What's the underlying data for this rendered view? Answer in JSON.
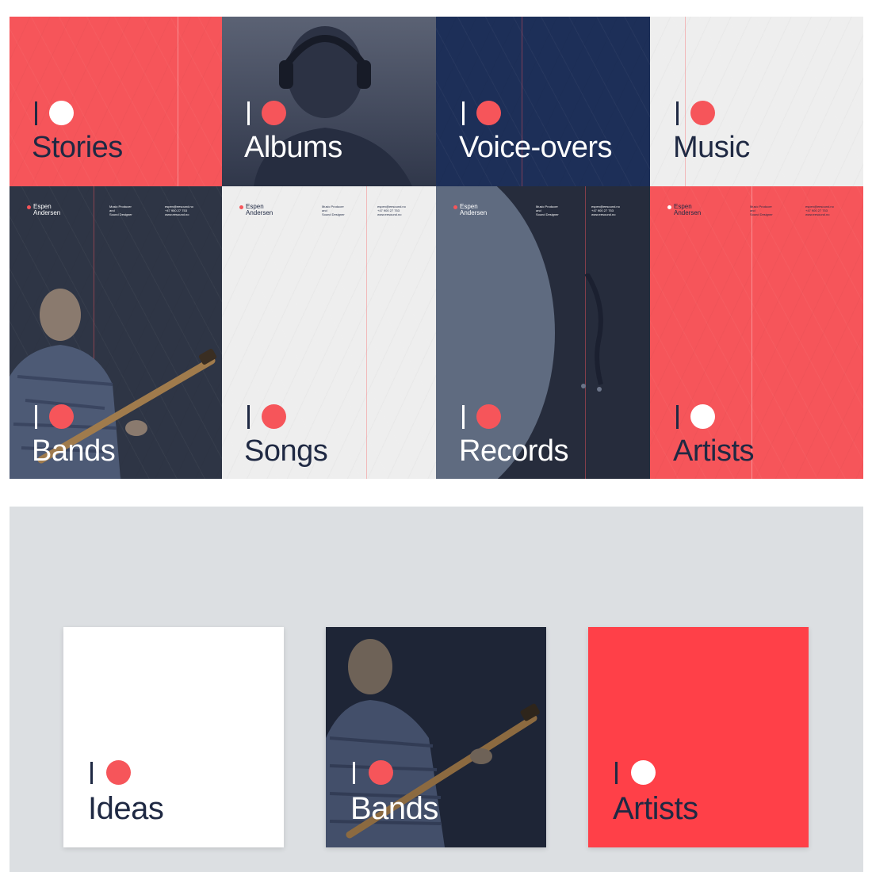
{
  "colors": {
    "red": "#f6555a",
    "navy": "#1d2f58",
    "slate": "#2e3545",
    "paper": "#eeeeee",
    "ink": "#1f2943",
    "white": "#ffffff",
    "panel": "#dcdfe2",
    "dark_card": "#1e2536",
    "bright_red": "#ff4048"
  },
  "header": {
    "name_line1": "Espen",
    "name_line2": "Andersen",
    "role_line1": "Music Producer",
    "role_line2": "and",
    "role_line3": "Sound Designer",
    "email": "espen@eesound.no",
    "phone": "+47 900 27 753",
    "website": "www.eesound.no"
  },
  "top_row": [
    {
      "word": "Stories"
    },
    {
      "word": "Albums"
    },
    {
      "word": "Voice-overs"
    },
    {
      "word": "Music"
    }
  ],
  "poster_row": [
    {
      "word": "Bands"
    },
    {
      "word": "Songs"
    },
    {
      "word": "Records"
    },
    {
      "word": "Artists"
    }
  ],
  "cards": [
    {
      "word": "Ideas"
    },
    {
      "word": "Bands"
    },
    {
      "word": "Artists"
    }
  ]
}
